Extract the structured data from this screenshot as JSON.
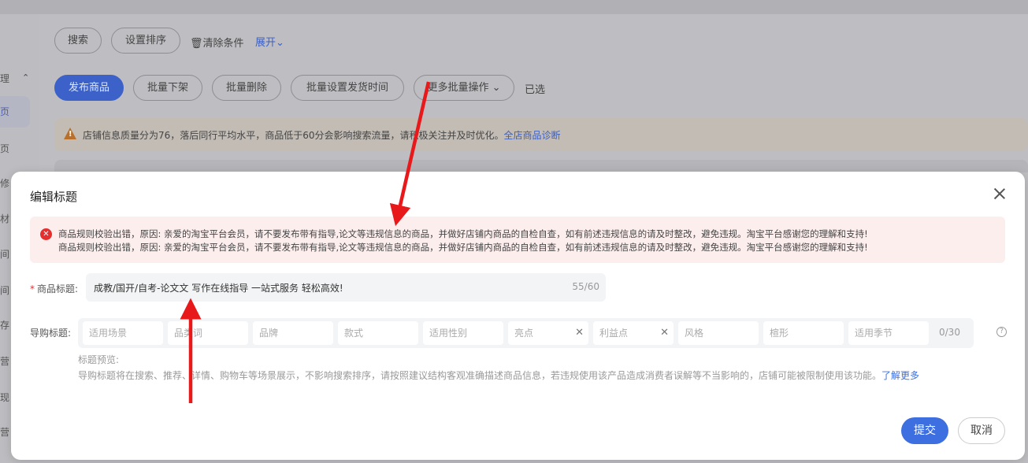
{
  "background": {
    "sidebar_items": [
      "理",
      "页",
      "页",
      "修",
      "材",
      "间",
      "间",
      "存",
      "营",
      "现",
      "营"
    ],
    "toolbar1": {
      "search": "搜索",
      "sort": "设置排序",
      "clear": "清除条件",
      "expand": "展开"
    },
    "toolbar2": {
      "publish": "发布商品",
      "batch_offshelf": "批量下架",
      "batch_delete": "批量删除",
      "batch_ship_time": "批量设置发货时间",
      "more_batch": "更多批量操作",
      "selected": "已选"
    },
    "warning": {
      "text": "店铺信息质量分为76，落后同行平均水平，商品低于60分会影响搜索流量，请积极关注并及时优化。",
      "link": "全店商品诊断"
    }
  },
  "modal": {
    "title": "编辑标题",
    "errors": [
      "商品规则校验出错，原因: 亲爱的淘宝平台会员，请不要发布带有指导,论文等违规信息的商品，并做好店铺内商品的自检自查，如有前述违规信息的请及时整改，避免违规。淘宝平台感谢您的理解和支持!",
      "商品规则校验出错，原因: 亲爱的淘宝平台会员，请不要发布带有指导,论文等违规信息的商品，并做好店铺内商品的自检自查，如有前述违规信息的请及时整改，避免违规。淘宝平台感谢您的理解和支持!"
    ],
    "title_field": {
      "label": "商品标题:",
      "value": "成教/国开/自考-论文文 写作在线指导 一站式服务 轻松高效!",
      "count": "55/60"
    },
    "guide_field": {
      "label": "导购标题:",
      "fields": [
        "适用场景",
        "品类词",
        "品牌",
        "款式",
        "适用性别",
        "亮点",
        "利益点",
        "风格",
        "楦形",
        "适用季节"
      ],
      "count": "0/30"
    },
    "preview": {
      "label": "标题预览:",
      "desc": "导购标题将在搜索、推荐、详情、购物车等场景展示，不影响搜索排序，请按照建议结构客观准确描述商品信息，若违规使用该产品造成消费者误解等不当影响的，店铺可能被限制使用该功能。",
      "link": "了解更多"
    },
    "submit": "提交",
    "cancel": "取消"
  },
  "colors": {
    "primary": "#3d6fe0",
    "error": "#e62e2e",
    "arrow": "#e8191b"
  }
}
